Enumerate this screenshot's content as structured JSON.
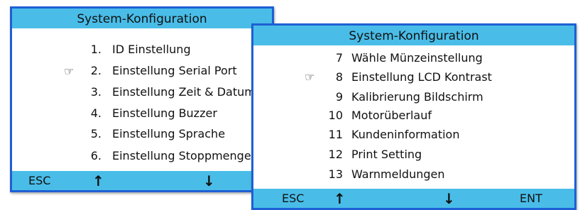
{
  "colors": {
    "header": "#49bde8",
    "frame": "#1f5fd4",
    "background": "#ffffff"
  },
  "screen_a": {
    "title": "System-Konfiguration",
    "selected_index": 1,
    "cursor_icon": "pointing-hand-icon",
    "cursor_glyph": "☞",
    "items": [
      {
        "num": "1.",
        "label": "ID Einstellung"
      },
      {
        "num": "2.",
        "label": "Einstellung Serial Port"
      },
      {
        "num": "3.",
        "label": "Einstellung Zeit & Datum"
      },
      {
        "num": "4.",
        "label": "Einstellung Buzzer"
      },
      {
        "num": "5.",
        "label": "Einstellung Sprache"
      },
      {
        "num": "6.",
        "label": "Einstellung Stoppmenge"
      }
    ],
    "footer": {
      "esc": "ESC",
      "up": "↑",
      "down": "↓"
    }
  },
  "screen_b": {
    "title": "System-Konfiguration",
    "selected_index": 1,
    "cursor_icon": "pointing-hand-icon",
    "cursor_glyph": "☞",
    "items": [
      {
        "num": "7",
        "label": "Wähle Münzeinstellung"
      },
      {
        "num": "8",
        "label": "Einstellung LCD Kontrast"
      },
      {
        "num": "9",
        "label": "Kalibrierung Bildschirm"
      },
      {
        "num": "10",
        "label": "Motorüberlauf"
      },
      {
        "num": "11",
        "label": "Kundeninformation"
      },
      {
        "num": "12",
        "label": "Print Setting"
      },
      {
        "num": "13",
        "label": "Warnmeldungen"
      }
    ],
    "footer": {
      "esc": "ESC",
      "up": "↑",
      "down": "↓",
      "ent": "ENT"
    }
  }
}
